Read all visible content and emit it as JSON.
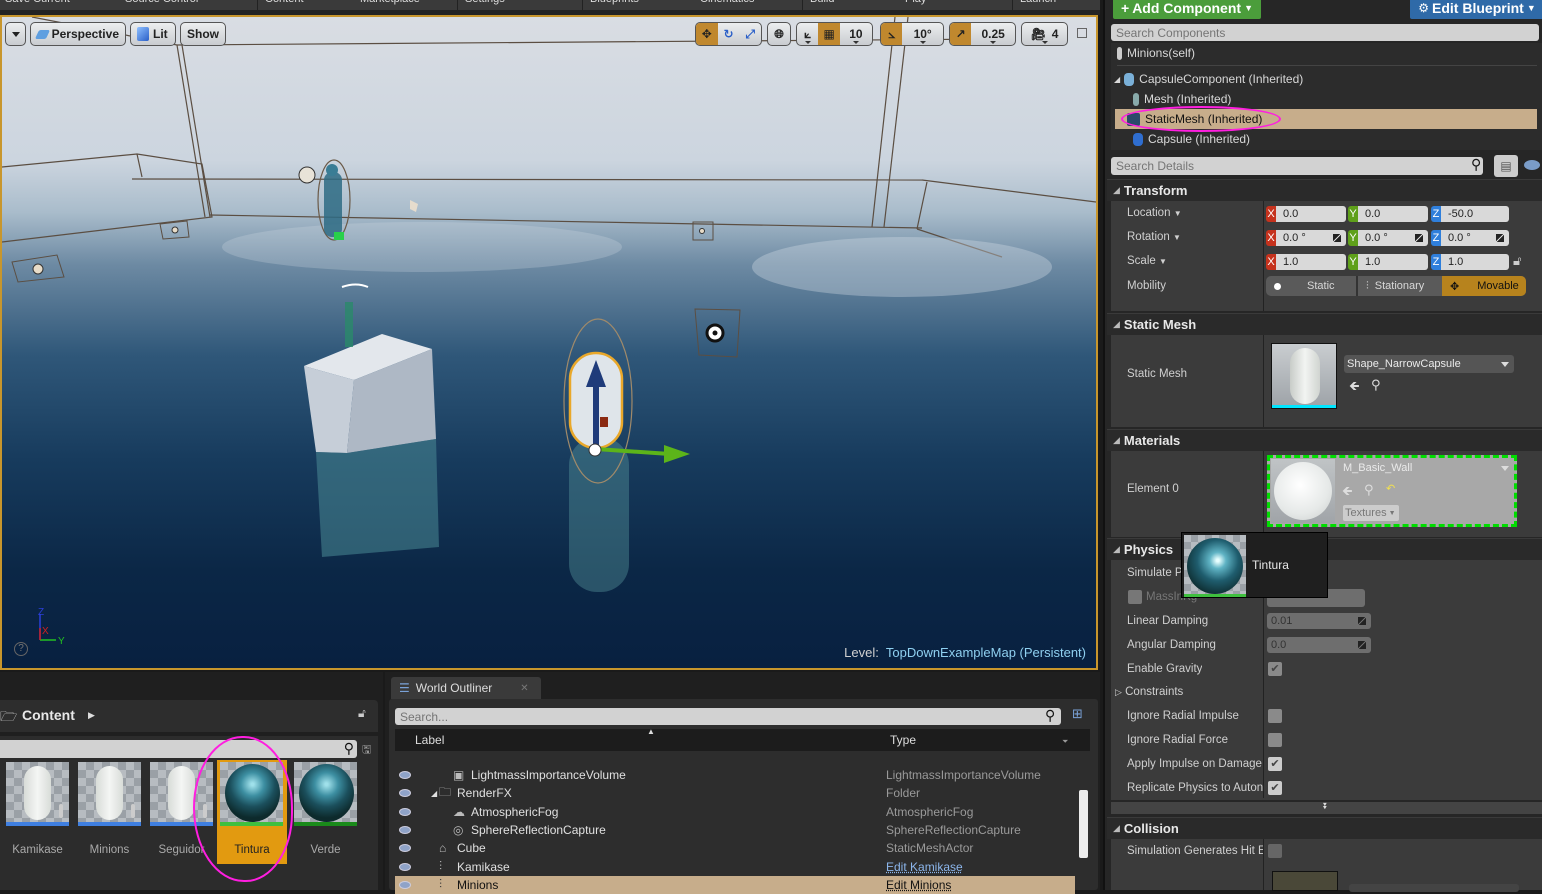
{
  "toolbar": {
    "items": [
      "Save Current",
      "Source Control",
      "Content",
      "Marketplace",
      "Settings",
      "Blueprints",
      "Cinematics",
      "Build",
      "Play",
      "Launch"
    ]
  },
  "viewport": {
    "view_mode": "Perspective",
    "lighting": "Lit",
    "show": "Show",
    "grid_snap": "10",
    "rotation_snap": "10°",
    "scale_snap": "0.25",
    "camera_speed": "4",
    "level_prefix": "Level:",
    "level_name": "TopDownExampleMap (Persistent)",
    "axis": {
      "z": "Z",
      "x": "X",
      "y": "Y"
    },
    "active_tool": "translate"
  },
  "components": {
    "add_label": "Add Component",
    "edit_label": "Edit Blueprint",
    "search_placeholder": "Search Components",
    "tree": [
      {
        "label": "Minions(self)",
        "indent": 0
      },
      {
        "label": "CapsuleComponent (Inherited)",
        "indent": 1,
        "expanded": true
      },
      {
        "label": "Mesh (Inherited)",
        "indent": 2
      },
      {
        "label": "StaticMesh (Inherited)",
        "indent": 2,
        "selected": true
      },
      {
        "label": "Capsule (Inherited)",
        "indent": 2
      }
    ]
  },
  "details": {
    "search_placeholder": "Search Details",
    "transform": {
      "title": "Transform",
      "location_label": "Location",
      "rotation_label": "Rotation",
      "scale_label": "Scale",
      "mobility_label": "Mobility",
      "location": {
        "x": "0.0",
        "y": "0.0",
        "z": "-50.0"
      },
      "rotation": {
        "x": "0.0 °",
        "y": "0.0 °",
        "z": "0.0 °"
      },
      "scale": {
        "x": "1.0",
        "y": "1.0",
        "z": "1.0"
      },
      "mobility_options": [
        "Static",
        "Stationary",
        "Movable"
      ],
      "mobility_selected": "Movable"
    },
    "static_mesh": {
      "title": "Static Mesh",
      "label": "Static Mesh",
      "value": "Shape_NarrowCapsule"
    },
    "materials": {
      "title": "Materials",
      "element_label": "Element 0",
      "value": "M_Basic_Wall",
      "textures_label": "Textures"
    },
    "physics": {
      "title": "Physics",
      "simulate_label": "Simulate Ph",
      "mass_label": "MassInKg",
      "linear_damping_label": "Linear Damping",
      "linear_damping": "0.01",
      "angular_damping_label": "Angular Damping",
      "angular_damping": "0.0",
      "gravity_label": "Enable Gravity",
      "gravity": true,
      "constraints_label": "Constraints",
      "ignore_radial_impulse_label": "Ignore Radial Impulse",
      "ignore_radial_impulse": false,
      "ignore_radial_force_label": "Ignore Radial Force",
      "ignore_radial_force": false,
      "apply_impulse_label": "Apply Impulse on Damage",
      "apply_impulse": true,
      "replicate_label": "Replicate Physics to Auton",
      "replicate": true
    },
    "collision": {
      "title": "Collision",
      "sim_hit_label": "Simulation Generates Hit E",
      "sim_hit": false
    }
  },
  "drag_tooltip": {
    "label": "Tintura"
  },
  "content_browser": {
    "title": "Content",
    "assets": [
      {
        "name": "Kamikase",
        "kind": "blueprint",
        "bar": "#3f7fe0"
      },
      {
        "name": "Minions",
        "kind": "blueprint",
        "bar": "#3f7fe0"
      },
      {
        "name": "Seguidor",
        "kind": "blueprint",
        "bar": "#3f7fe0"
      },
      {
        "name": "Tintura",
        "kind": "material",
        "bar": "#3fbf3f",
        "selected": true
      },
      {
        "name": "Verde",
        "kind": "material",
        "bar": "#1a8a1a"
      }
    ]
  },
  "outliner": {
    "tab_label": "World Outliner",
    "search_placeholder": "Search...",
    "col_label": "Label",
    "col_type": "Type",
    "rows": [
      {
        "label": "LightmassImportanceVolume",
        "type": "LightmassImportanceVolume",
        "indent": 2,
        "link": false
      },
      {
        "label": "RenderFX",
        "type": "Folder",
        "indent": 1,
        "link": false,
        "folder": true
      },
      {
        "label": "AtmosphericFog",
        "type": "AtmosphericFog",
        "indent": 2,
        "link": false
      },
      {
        "label": "SphereReflectionCapture",
        "type": "SphereReflectionCapture",
        "indent": 2,
        "link": false
      },
      {
        "label": "Cube",
        "type": "StaticMeshActor",
        "indent": 1,
        "link": false
      },
      {
        "label": "Kamikase",
        "type": "Edit Kamikase",
        "indent": 1,
        "link": true
      },
      {
        "label": "Minions",
        "type": "Edit Minions",
        "indent": 1,
        "link": true,
        "selected": true
      }
    ]
  },
  "colors": {
    "accent_orange": "#c0882e",
    "selection": "#c7ad8b",
    "add_green": "#4b9d3b",
    "edit_blue": "#2f6aa8",
    "annotation_magenta": "#ff1ee0",
    "drop_target_green": "#00dd00"
  }
}
